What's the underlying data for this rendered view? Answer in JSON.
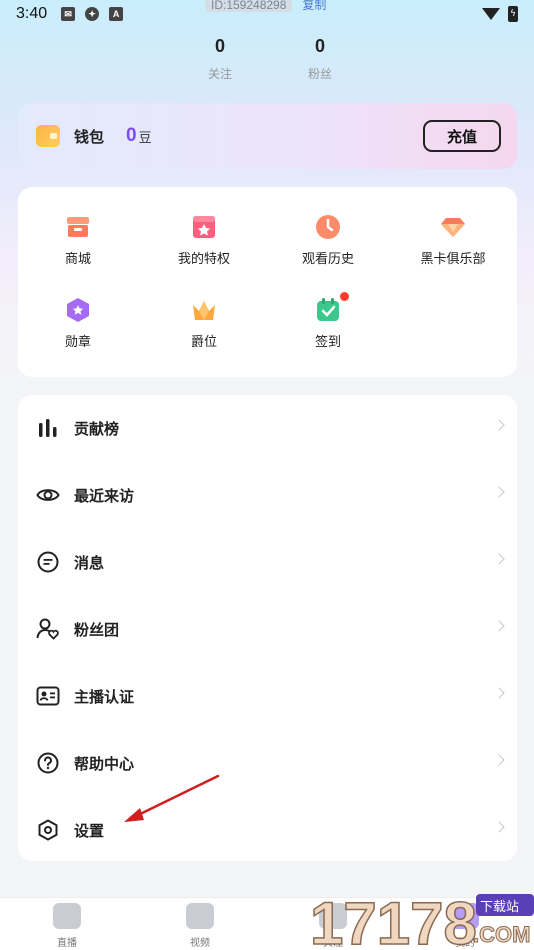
{
  "status_bar": {
    "time": "3:40",
    "icons": [
      "message-icon",
      "globe-icon",
      "app-a-icon",
      "wifi-icon",
      "battery-icon"
    ],
    "app_icon_letter": "A"
  },
  "profile": {
    "id_text": "ID:159248298",
    "copy_label": "复制",
    "stats": [
      {
        "value": "0",
        "label": "关注"
      },
      {
        "value": "0",
        "label": "粉丝"
      }
    ]
  },
  "wallet": {
    "label": "钱包",
    "amount": "0",
    "unit": "豆",
    "recharge_label": "充值",
    "accent": "#7b4cf5"
  },
  "features": [
    {
      "label": "商城",
      "icon": "shop-icon",
      "color": "#ff8a6a"
    },
    {
      "label": "我的特权",
      "icon": "privilege-icon",
      "color": "#ff5f7e"
    },
    {
      "label": "观看历史",
      "icon": "history-clock-icon",
      "color": "#ff8a6a"
    },
    {
      "label": "黑卡俱乐部",
      "icon": "diamond-icon",
      "color": "#ff8a6a"
    },
    {
      "label": "勋章",
      "icon": "medal-icon",
      "color": "#a66bf5"
    },
    {
      "label": "爵位",
      "icon": "crown-icon",
      "color": "#ffa63d"
    },
    {
      "label": "签到",
      "icon": "checkin-calendar-icon",
      "color": "#3cc88c",
      "badge": true
    }
  ],
  "menu": [
    {
      "label": "贡献榜",
      "icon": "ranking-bars-icon"
    },
    {
      "label": "最近来访",
      "icon": "eye-icon"
    },
    {
      "label": "消息",
      "icon": "message-bubble-icon"
    },
    {
      "label": "粉丝团",
      "icon": "fan-club-icon"
    },
    {
      "label": "主播认证",
      "icon": "id-card-icon"
    },
    {
      "label": "帮助中心",
      "icon": "help-icon"
    },
    {
      "label": "设置",
      "icon": "settings-hexagon-icon"
    }
  ],
  "tabbar": [
    {
      "label": "直播",
      "icon": "live-tv-icon"
    },
    {
      "label": "视频",
      "icon": "video-camera-icon"
    },
    {
      "label": "关注",
      "icon": "follow-icon"
    },
    {
      "label": "我的",
      "icon": "profile-icon"
    }
  ],
  "watermark": {
    "digits": "17178",
    "tag": "下载站",
    "domain": ".COM"
  }
}
